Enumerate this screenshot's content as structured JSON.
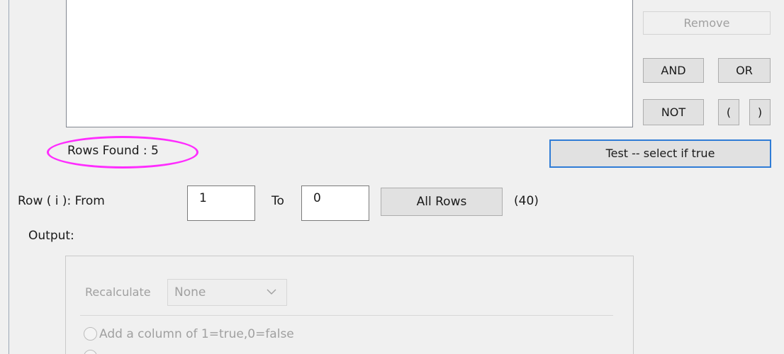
{
  "expression_box": {
    "content": ""
  },
  "operator_buttons": {
    "remove": "Remove",
    "and": "AND",
    "or": "OR",
    "not": "NOT",
    "open_paren": "(",
    "close_paren": ")"
  },
  "status": {
    "rows_found": "Rows Found : 5",
    "highlight_color": "#ff2cff"
  },
  "test_button": {
    "label": "Test -- select if true",
    "focus_color": "#2f7cd6"
  },
  "row_range": {
    "label": "Row ( i ):  From",
    "from_value": "1",
    "to_label": "To",
    "to_value": "0",
    "all_rows_label": "All Rows",
    "total_count": "(40)"
  },
  "output": {
    "label": "Output:",
    "recalculate_label": "Recalculate",
    "recalculate_value": "None",
    "option_add_column": "Add a column of 1=true,0=false"
  }
}
